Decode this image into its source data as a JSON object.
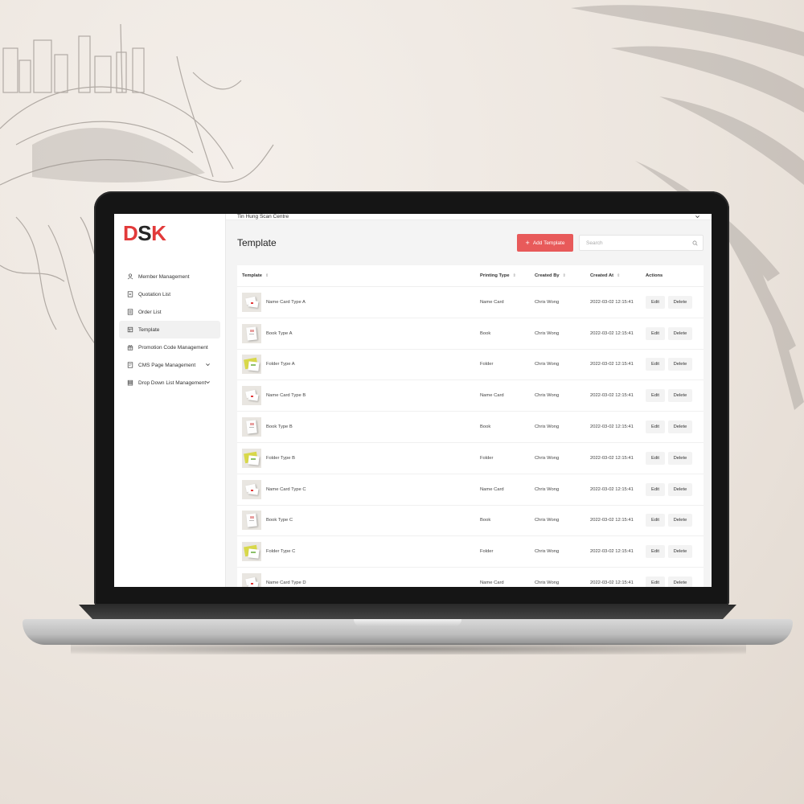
{
  "app": {
    "logo_letters": [
      "D",
      "S",
      "K"
    ],
    "org_name": "Tin Hung Scan Centre"
  },
  "sidebar": {
    "items": [
      {
        "label": "Member Management",
        "icon": "user-icon",
        "active": false,
        "expandable": false
      },
      {
        "label": "Quotation List",
        "icon": "document-icon",
        "active": false,
        "expandable": false
      },
      {
        "label": "Order List",
        "icon": "list-icon",
        "active": false,
        "expandable": false
      },
      {
        "label": "Template",
        "icon": "template-icon",
        "active": true,
        "expandable": false
      },
      {
        "label": "Promotion Code Management",
        "icon": "gift-icon",
        "active": false,
        "expandable": false
      },
      {
        "label": "CMS Page Management",
        "icon": "page-icon",
        "active": false,
        "expandable": true
      },
      {
        "label": "Drop Down List Management",
        "icon": "stack-icon",
        "active": false,
        "expandable": true
      }
    ]
  },
  "main": {
    "title": "Template",
    "add_button": "Add Template",
    "search_placeholder": "Search",
    "columns": [
      "Template",
      "Printing Type",
      "Created By",
      "Created At",
      "Actions"
    ],
    "edit_label": "Edit",
    "delete_label": "Delete",
    "rows": [
      {
        "template": "Name Card Type A",
        "type": "Name Card",
        "by": "Chris Wong",
        "at": "2022-03-02 12:15:41",
        "thumb": "card"
      },
      {
        "template": "Book Type A",
        "type": "Book",
        "by": "Chris Wong",
        "at": "2022-03-02 12:15:41",
        "thumb": "book"
      },
      {
        "template": "Folder Type A",
        "type": "Folder",
        "by": "Chris Wong",
        "at": "2022-03-02 12:15:41",
        "thumb": "folder"
      },
      {
        "template": "Name Card Type B",
        "type": "Name Card",
        "by": "Chris Wong",
        "at": "2022-03-02 12:15:41",
        "thumb": "card"
      },
      {
        "template": "Book Type B",
        "type": "Book",
        "by": "Chris Wong",
        "at": "2022-03-02 12:15:41",
        "thumb": "book"
      },
      {
        "template": "Folder Type B",
        "type": "Folder",
        "by": "Chris Wong",
        "at": "2022-03-02 12:15:41",
        "thumb": "folder"
      },
      {
        "template": "Name Card Type C",
        "type": "Name Card",
        "by": "Chris Wong",
        "at": "2022-03-02 12:15:41",
        "thumb": "card"
      },
      {
        "template": "Book Type C",
        "type": "Book",
        "by": "Chris Wong",
        "at": "2022-03-02 12:15:41",
        "thumb": "book"
      },
      {
        "template": "Folder Type C",
        "type": "Folder",
        "by": "Chris Wong",
        "at": "2022-03-02 12:15:41",
        "thumb": "folder"
      },
      {
        "template": "Name Card Type D",
        "type": "Name Card",
        "by": "Chris Wong",
        "at": "2022-03-02 12:15:41",
        "thumb": "card"
      }
    ]
  },
  "colors": {
    "brand_red": "#e23a3a",
    "button_red": "#e85a5a"
  }
}
